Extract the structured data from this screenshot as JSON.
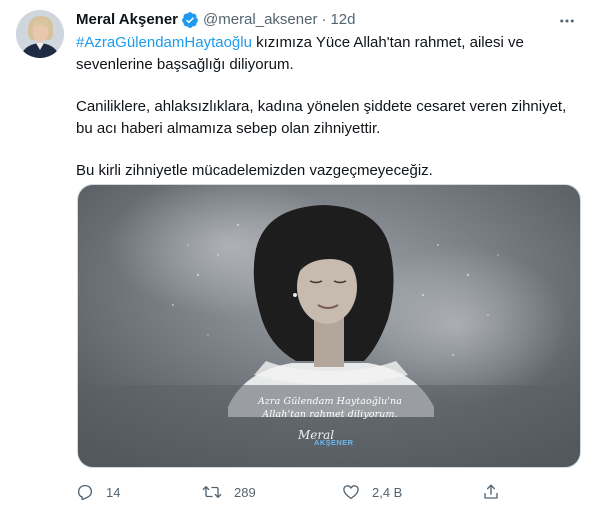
{
  "tweet": {
    "author_name": "Meral Akşener",
    "author_handle": "@meral_aksener",
    "separator": "·",
    "age": "12d",
    "hashtag": "#AzraGülendamHaytaoğlu",
    "para1_rest": " kızımıza Yüce Allah'tan rahmet, ailesi ve sevenlerine başsağlığı diliyorum.",
    "para2": "Caniliklere, ahlaksızlıklara, kadına yönelen şiddete cesaret veren zihniyet, bu acı haberi almamıza sebep olan zihniyettir.",
    "para3": "Bu kirli zihniyetle mücadelemizden vazgeçmeyeceğiz."
  },
  "media": {
    "caption_line1": "Azra Gülendam Haytaoğlu'na",
    "caption_line2": "Allah'tan rahmet diliyorum.",
    "signature_script": "Meral",
    "signature_brand": "AKŞENER"
  },
  "actions": {
    "reply_count": "14",
    "retweet_count": "289",
    "like_count": "2,4 B"
  },
  "icons": {
    "more": "more-horizontal-icon",
    "verified": "verified-badge-icon",
    "reply": "reply-icon",
    "retweet": "retweet-icon",
    "like": "heart-icon",
    "share": "share-icon"
  },
  "colors": {
    "accent": "#1d9bf0",
    "text": "#0f1419",
    "muted": "#536471"
  }
}
